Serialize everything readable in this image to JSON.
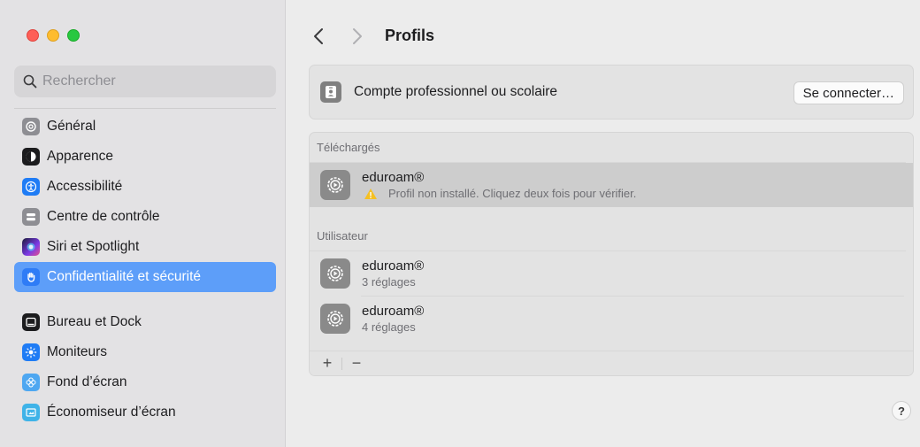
{
  "sidebar": {
    "search": {
      "placeholder": "Rechercher"
    },
    "items": [
      {
        "label": "Général",
        "icon": "gear-icon",
        "color": "#8e8e93"
      },
      {
        "label": "Apparence",
        "icon": "appearance-icon",
        "color": "#1c1c1e"
      },
      {
        "label": "Accessibilité",
        "icon": "accessibility-icon",
        "color": "#1f7cf5"
      },
      {
        "label": "Centre de contrôle",
        "icon": "control-center-icon",
        "color": "#8e8e93"
      },
      {
        "label": "Siri et Spotlight",
        "icon": "siri-icon",
        "color": "#7b3ae6"
      },
      {
        "label": "Confidentialité et sécurité",
        "icon": "hand-icon",
        "color": "#2f7cf6",
        "selected": true
      },
      {
        "label": "Bureau et Dock",
        "icon": "dock-icon",
        "color": "#1c1c1e"
      },
      {
        "label": "Moniteurs",
        "icon": "brightness-icon",
        "color": "#1f7cf5"
      },
      {
        "label": "Fond d’écran",
        "icon": "wallpaper-icon",
        "color": "#4ea7f1"
      },
      {
        "label": "Économiseur d’écran",
        "icon": "screensaver-icon",
        "color": "#3fb3e8"
      }
    ]
  },
  "header": {
    "title": "Profils"
  },
  "account": {
    "label": "Compte professionnel ou scolaire",
    "button": "Se connecter…"
  },
  "downloaded": {
    "heading": "Téléchargés",
    "items": [
      {
        "name": "eduroam®",
        "detail": "Profil non installé. Cliquez deux fois pour vérifier."
      }
    ]
  },
  "user": {
    "heading": "Utilisateur",
    "items": [
      {
        "name": "eduroam®",
        "detail": "3 réglages"
      },
      {
        "name": "eduroam®",
        "detail": "4 réglages"
      }
    ]
  },
  "footer": {
    "add": "+",
    "remove": "−"
  },
  "help": {
    "label": "?"
  }
}
